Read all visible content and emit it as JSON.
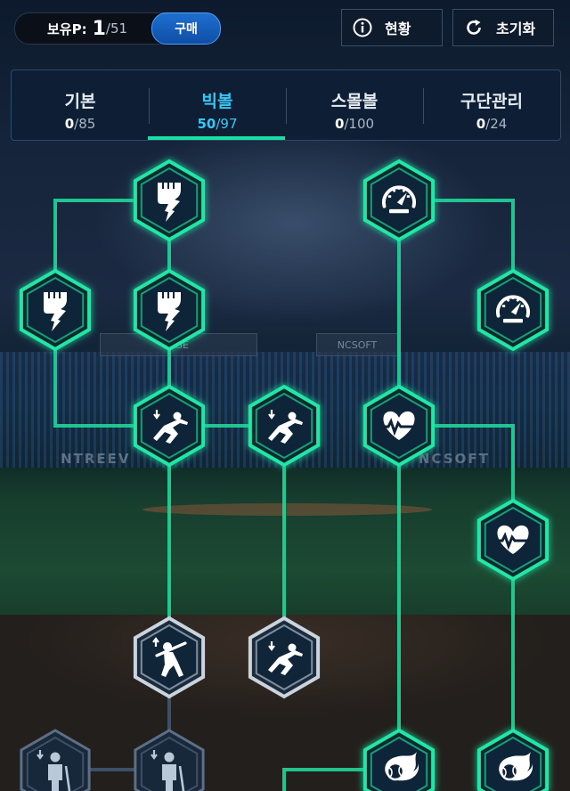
{
  "points": {
    "label": "보유P:",
    "current": "1",
    "max": "/51"
  },
  "buy_label": "구매",
  "status_label": "현황",
  "reset_label": "초기화",
  "tabs": [
    {
      "name": "기본",
      "done": "0",
      "total": "/85"
    },
    {
      "name": "빅볼",
      "done": "50",
      "total": "/97"
    },
    {
      "name": "스몰볼",
      "done": "0",
      "total": "/100"
    },
    {
      "name": "구단관리",
      "done": "0",
      "total": "/24"
    }
  ],
  "active_tab": "빅볼",
  "background_text": {
    "sponsor_1": "NCSOFT",
    "sponsor_2": "NTREEV",
    "sponsor_3": "NCSOFT",
    "billboard": "AGE"
  },
  "nodes": [
    {
      "icon": "power-fist-icon",
      "state": "active"
    },
    {
      "icon": "speedometer-icon",
      "state": "active"
    },
    {
      "icon": "power-fist-icon",
      "state": "active"
    },
    {
      "icon": "power-fist-icon",
      "state": "active"
    },
    {
      "icon": "speedometer-icon",
      "state": "active"
    },
    {
      "icon": "slide-runner-icon",
      "state": "active"
    },
    {
      "icon": "slide-runner-icon",
      "state": "active"
    },
    {
      "icon": "heart-pulse-icon",
      "state": "active"
    },
    {
      "icon": "heart-pulse-icon",
      "state": "active"
    },
    {
      "icon": "batter-swing-icon",
      "state": "available"
    },
    {
      "icon": "slide-runner-icon",
      "state": "available"
    },
    {
      "icon": "batter-stance-icon",
      "state": "locked"
    },
    {
      "icon": "batter-stance-icon",
      "state": "locked"
    },
    {
      "icon": "fireball-icon",
      "state": "active"
    },
    {
      "icon": "fireball-icon",
      "state": "active"
    }
  ],
  "colors": {
    "accent_green": "#18e0a4",
    "tab_active": "#38c7f5",
    "buy_blue": "#1e6fd0"
  }
}
